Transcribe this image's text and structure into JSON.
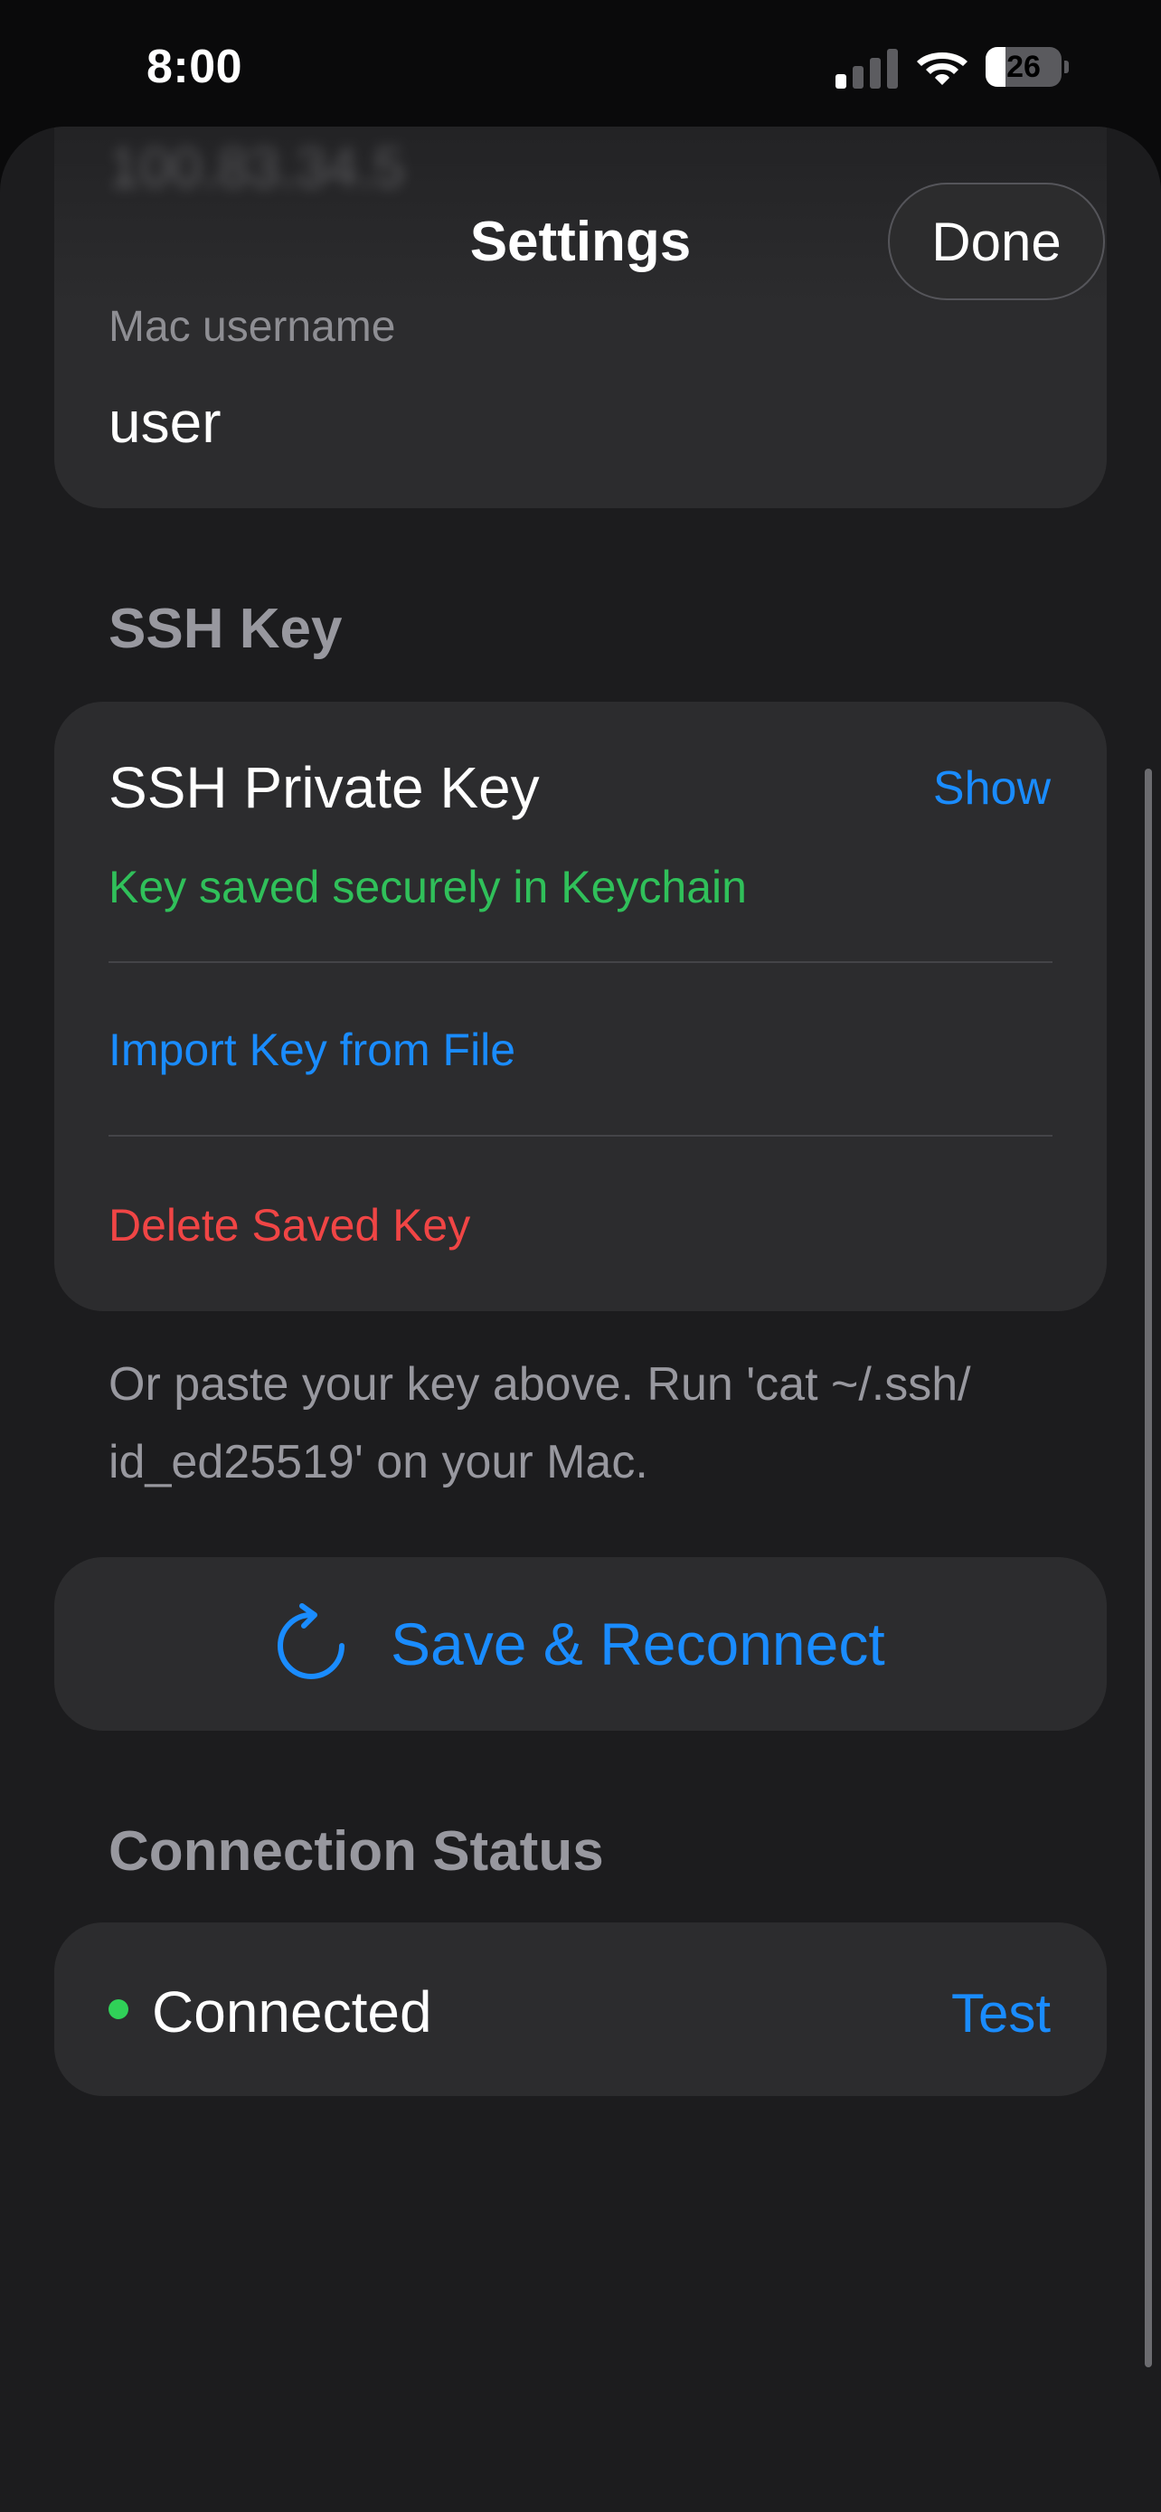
{
  "status_bar": {
    "time": "8:00",
    "battery_level": "26",
    "signal_bars_active": 1,
    "signal_bars_total": 4
  },
  "nav": {
    "title": "Settings",
    "done_label": "Done"
  },
  "connection_fields": {
    "host_value": "100.83.34.5",
    "username_label": "Mac username",
    "username_value": "user"
  },
  "ssh_section": {
    "header": "SSH Key",
    "key_title": "SSH Private Key",
    "show_label": "Show",
    "key_status": "Key saved securely in Keychain",
    "import_label": "Import Key from File",
    "delete_label": "Delete Saved Key",
    "footnote": "Or paste your key above. Run 'cat ~/.ssh/ id_ed25519' on your Mac."
  },
  "actions": {
    "save_label": "Save & Reconnect"
  },
  "connection_status": {
    "header": "Connection Status",
    "status_text": "Connected",
    "test_label": "Test"
  },
  "colors": {
    "accent": "#1a8cff",
    "success": "#30c05a",
    "destructive": "#f04545",
    "status_dot": "#30d158",
    "background": "#1c1c1e",
    "card": "#2c2c2e"
  },
  "icons": {
    "save": "arrow-clockwise-icon",
    "status": "status-dot-icon",
    "wifi": "wifi-icon",
    "signal": "cellular-signal-icon",
    "battery": "battery-icon"
  }
}
